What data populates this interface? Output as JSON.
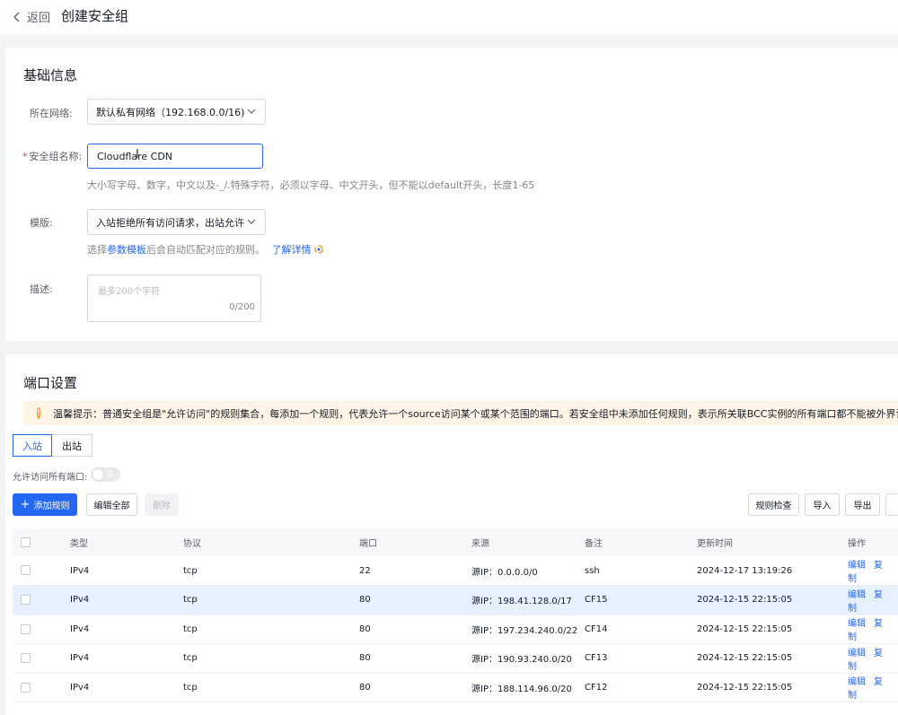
{
  "header": {
    "back_label": "返回",
    "title": "创建安全组"
  },
  "basic": {
    "title": "基础信息",
    "network_label": "所在网络:",
    "network_value": "默认私有网络（192.168.0.0/16)",
    "name_label": "安全组名称:",
    "name_required": "*",
    "name_value": "Cloudflare CDN",
    "name_hint": "大小写字母、数字，中文以及-_/.特殊字符，必须以字母、中文开头，但不能以default开头，长度1-65",
    "template_label": "模版:",
    "template_value": "入站拒绝所有访问请求，出站允许",
    "template_hint_prefix": "选择",
    "template_hint_link": "参数模板",
    "template_hint_middle": "后会自动匹配对应的规则。",
    "template_hint_more": "了解详情",
    "desc_label": "描述:",
    "desc_placeholder": "最多200个字符",
    "desc_count": "0/200"
  },
  "ports": {
    "title": "端口设置",
    "tip_icon": "!",
    "tip": "温馨提示：普通安全组是\"允许访问\"的规则集合，每添加一个规则，代表允许一个source访问某个或某个范围的端口。若安全组中未添加任何规则，表示所关联BCC实例的所有端口都不能被外界访问",
    "tabs": [
      "入站",
      "出站"
    ],
    "allow_all_label": "允许访问所有端口:",
    "toggle_label": "关",
    "buttons": {
      "add": "添加规则",
      "add_icon": "+",
      "edit_all": "编辑全部",
      "delete": "删除",
      "check": "规则检查",
      "import": "导入",
      "export": "导出"
    },
    "columns": [
      "类型",
      "协议",
      "端口",
      "来源",
      "备注",
      "更新时间",
      "操作"
    ],
    "rows": [
      {
        "type": "IPv4",
        "protocol": "tcp",
        "port": "22",
        "source": "源IP：0.0.0.0/0",
        "note": "ssh",
        "updated": "2024-12-17 13:19:26"
      },
      {
        "type": "IPv4",
        "protocol": "tcp",
        "port": "80",
        "source": "源IP：198.41.128.0/17",
        "note": "CF15",
        "updated": "2024-12-15 22:15:05"
      },
      {
        "type": "IPv4",
        "protocol": "tcp",
        "port": "80",
        "source": "源IP：197.234.240.0/22",
        "note": "CF14",
        "updated": "2024-12-15 22:15:05"
      },
      {
        "type": "IPv4",
        "protocol": "tcp",
        "port": "80",
        "source": "源IP：190.93.240.0/20",
        "note": "CF13",
        "updated": "2024-12-15 22:15:05"
      },
      {
        "type": "IPv4",
        "protocol": "tcp",
        "port": "80",
        "source": "源IP：188.114.96.0/20",
        "note": "CF12",
        "updated": "2024-12-15 22:15:05"
      }
    ],
    "op_edit": "编辑",
    "op_copy": "复制"
  }
}
